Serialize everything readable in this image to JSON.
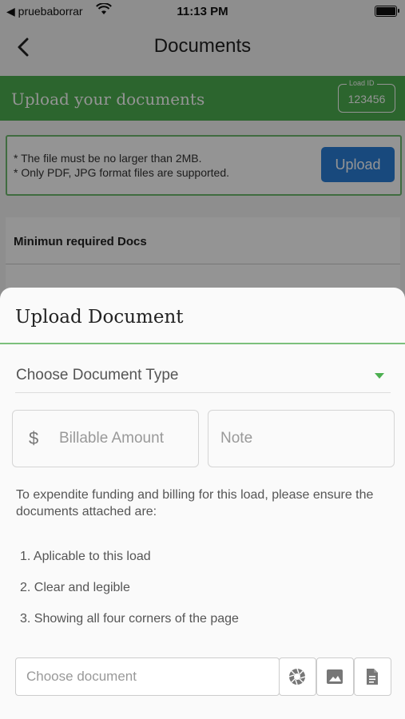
{
  "status_bar": {
    "back_app": "◀ pruebaborrar",
    "time": "11:13 PM"
  },
  "nav": {
    "title": "Documents"
  },
  "banner": {
    "label": "Upload your documents",
    "load_id_caption": "Load ID",
    "load_id": "123456"
  },
  "info": {
    "line1": "* The file must be no larger than 2MB.",
    "line2": "* Only PDF, JPG format files are supported.",
    "upload_label": "Upload"
  },
  "requirements": {
    "header": "Minimun required Docs"
  },
  "sheet": {
    "title": "Upload Document",
    "doc_type_placeholder": "Choose Document Type",
    "amount_symbol": "$",
    "amount_placeholder": "Billable Amount",
    "note_placeholder": "Note",
    "guidance": "To expendite funding and billing for this load, please ensure the documents attached are:",
    "steps": [
      "1. Aplicable to this load",
      "2. Clear and legible",
      "3. Showing all four corners of the page"
    ],
    "choose_placeholder": "Choose document",
    "accent_color": "#4caf50",
    "icons": [
      "camera-icon",
      "image-icon",
      "file-icon"
    ]
  }
}
